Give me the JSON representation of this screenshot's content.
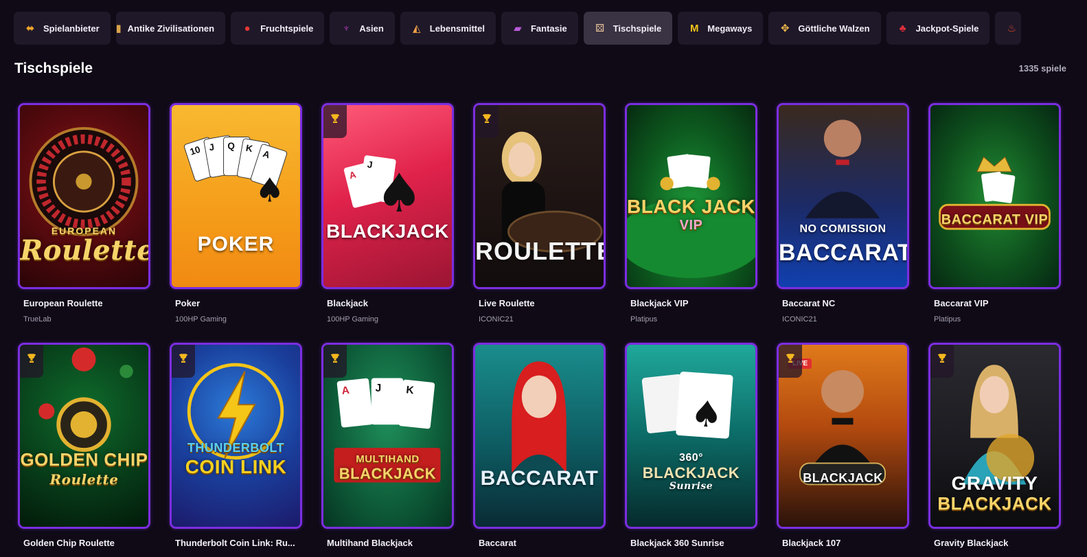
{
  "categories": [
    {
      "label": "Spielanbieter",
      "icon": "provider-icon",
      "active": false
    },
    {
      "label": "Antike Zivilisationen",
      "icon": "column-icon",
      "active": false
    },
    {
      "label": "Fruchtspiele",
      "icon": "strawberry-icon",
      "active": false
    },
    {
      "label": "Asien",
      "icon": "dragon-icon",
      "active": false
    },
    {
      "label": "Lebensmittel",
      "icon": "pizza-icon",
      "active": false
    },
    {
      "label": "Fantasie",
      "icon": "book-icon",
      "active": false
    },
    {
      "label": "Tischspiele",
      "icon": "dice-icon",
      "active": true
    },
    {
      "label": "Megaways",
      "icon": "m-icon",
      "active": false
    },
    {
      "label": "Göttliche Walzen",
      "icon": "wings-icon",
      "active": false
    },
    {
      "label": "Jackpot-Spiele",
      "icon": "cherry-icon",
      "active": false
    },
    {
      "label": "",
      "icon": "fire-icon",
      "active": false
    }
  ],
  "section": {
    "title": "Tischspiele",
    "count": "1335 spiele"
  },
  "games": [
    {
      "name": "European Roulette",
      "provider": "TrueLab",
      "art": "European Roulette",
      "trophy": false
    },
    {
      "name": "Poker",
      "provider": "100HP Gaming",
      "art": "POKER",
      "trophy": false
    },
    {
      "name": "Blackjack",
      "provider": "100HP Gaming",
      "art": "BLACKJACK",
      "trophy": true
    },
    {
      "name": "Live Roulette",
      "provider": "ICONIC21",
      "art": "LIVE ROULETTE",
      "trophy": true
    },
    {
      "name": "Blackjack VIP",
      "provider": "Platipus",
      "art": "BLACK JACK VIP",
      "trophy": false
    },
    {
      "name": "Baccarat NC",
      "provider": "ICONIC21",
      "art": "BACCARAT",
      "trophy": false
    },
    {
      "name": "Baccarat VIP",
      "provider": "Platipus",
      "art": "BACCARAT VIP",
      "trophy": false
    },
    {
      "name": "Golden Chip Roulette",
      "provider": "",
      "art": "GOLDEN CHIP Roulette",
      "trophy": true
    },
    {
      "name": "Thunderbolt Coin Link: Ru...",
      "provider": "",
      "art": "THUNDERBOLT COIN LINK",
      "trophy": true
    },
    {
      "name": "Multihand Blackjack",
      "provider": "",
      "art": "MULTIHAND BLACKJACK",
      "trophy": true
    },
    {
      "name": "Baccarat",
      "provider": "",
      "art": "BACCARAT",
      "trophy": false
    },
    {
      "name": "Blackjack 360 Sunrise",
      "provider": "",
      "art": "360° BLACKJACK Sunrise",
      "trophy": false
    },
    {
      "name": "Blackjack 107",
      "provider": "",
      "art": "BLACKJACK",
      "trophy": true,
      "live": "LIVE"
    },
    {
      "name": "Gravity Blackjack",
      "provider": "",
      "art": "GRAVITY BLACKJACK",
      "trophy": true
    }
  ]
}
